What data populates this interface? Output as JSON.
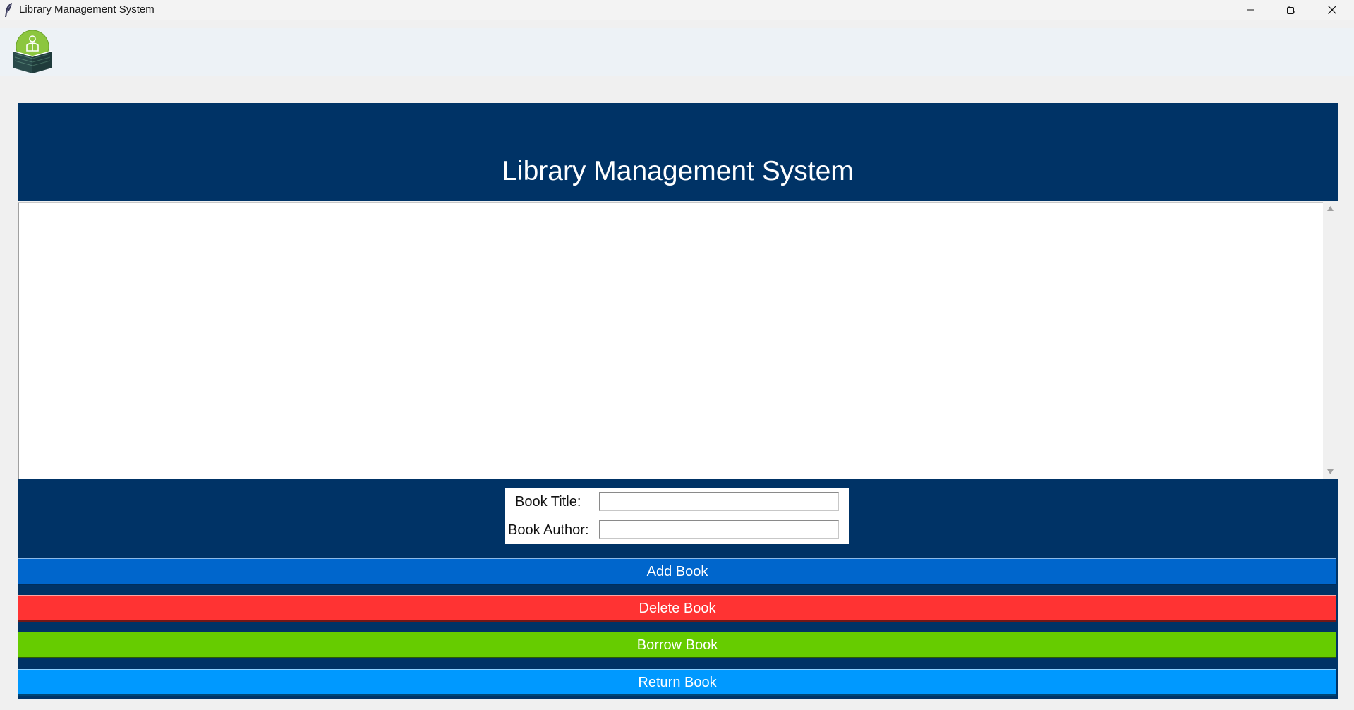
{
  "window": {
    "title": "Library Management System",
    "controls": {
      "minimize_icon": "minimize-icon",
      "maximize_icon": "restore-icon",
      "close_icon": "close-icon"
    }
  },
  "logo": {
    "icon": "library-book-logo"
  },
  "header": {
    "title": "Library Management System",
    "background": "#003366"
  },
  "book_list": {
    "items": []
  },
  "form": {
    "title_label": "Book Title:",
    "title_value": "",
    "author_label": "Book Author:",
    "author_value": ""
  },
  "buttons": {
    "add": {
      "label": "Add Book",
      "color": "#0066cc"
    },
    "delete": {
      "label": "Delete Book",
      "color": "#ff3333"
    },
    "borrow": {
      "label": "Borrow Book",
      "color": "#66cc00"
    },
    "return": {
      "label": "Return Book",
      "color": "#0099ff"
    }
  }
}
